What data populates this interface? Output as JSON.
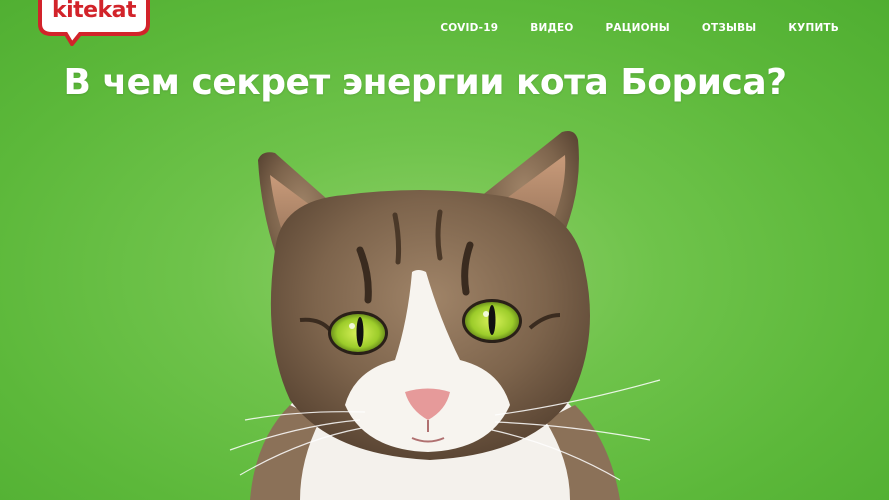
{
  "brand": {
    "logo_text": "kitekat",
    "logo_color": "#d2232a"
  },
  "nav": {
    "items": [
      {
        "label": "COVID-19"
      },
      {
        "label": "ВИДЕО"
      },
      {
        "label": "РАЦИОНЫ"
      },
      {
        "label": "ОТЗЫВЫ"
      },
      {
        "label": "КУПИТЬ"
      }
    ]
  },
  "hero": {
    "headline": "В чем секрет энергии кота Бориса?",
    "background_color": "#5cb83a",
    "image": "cat-portrait"
  }
}
